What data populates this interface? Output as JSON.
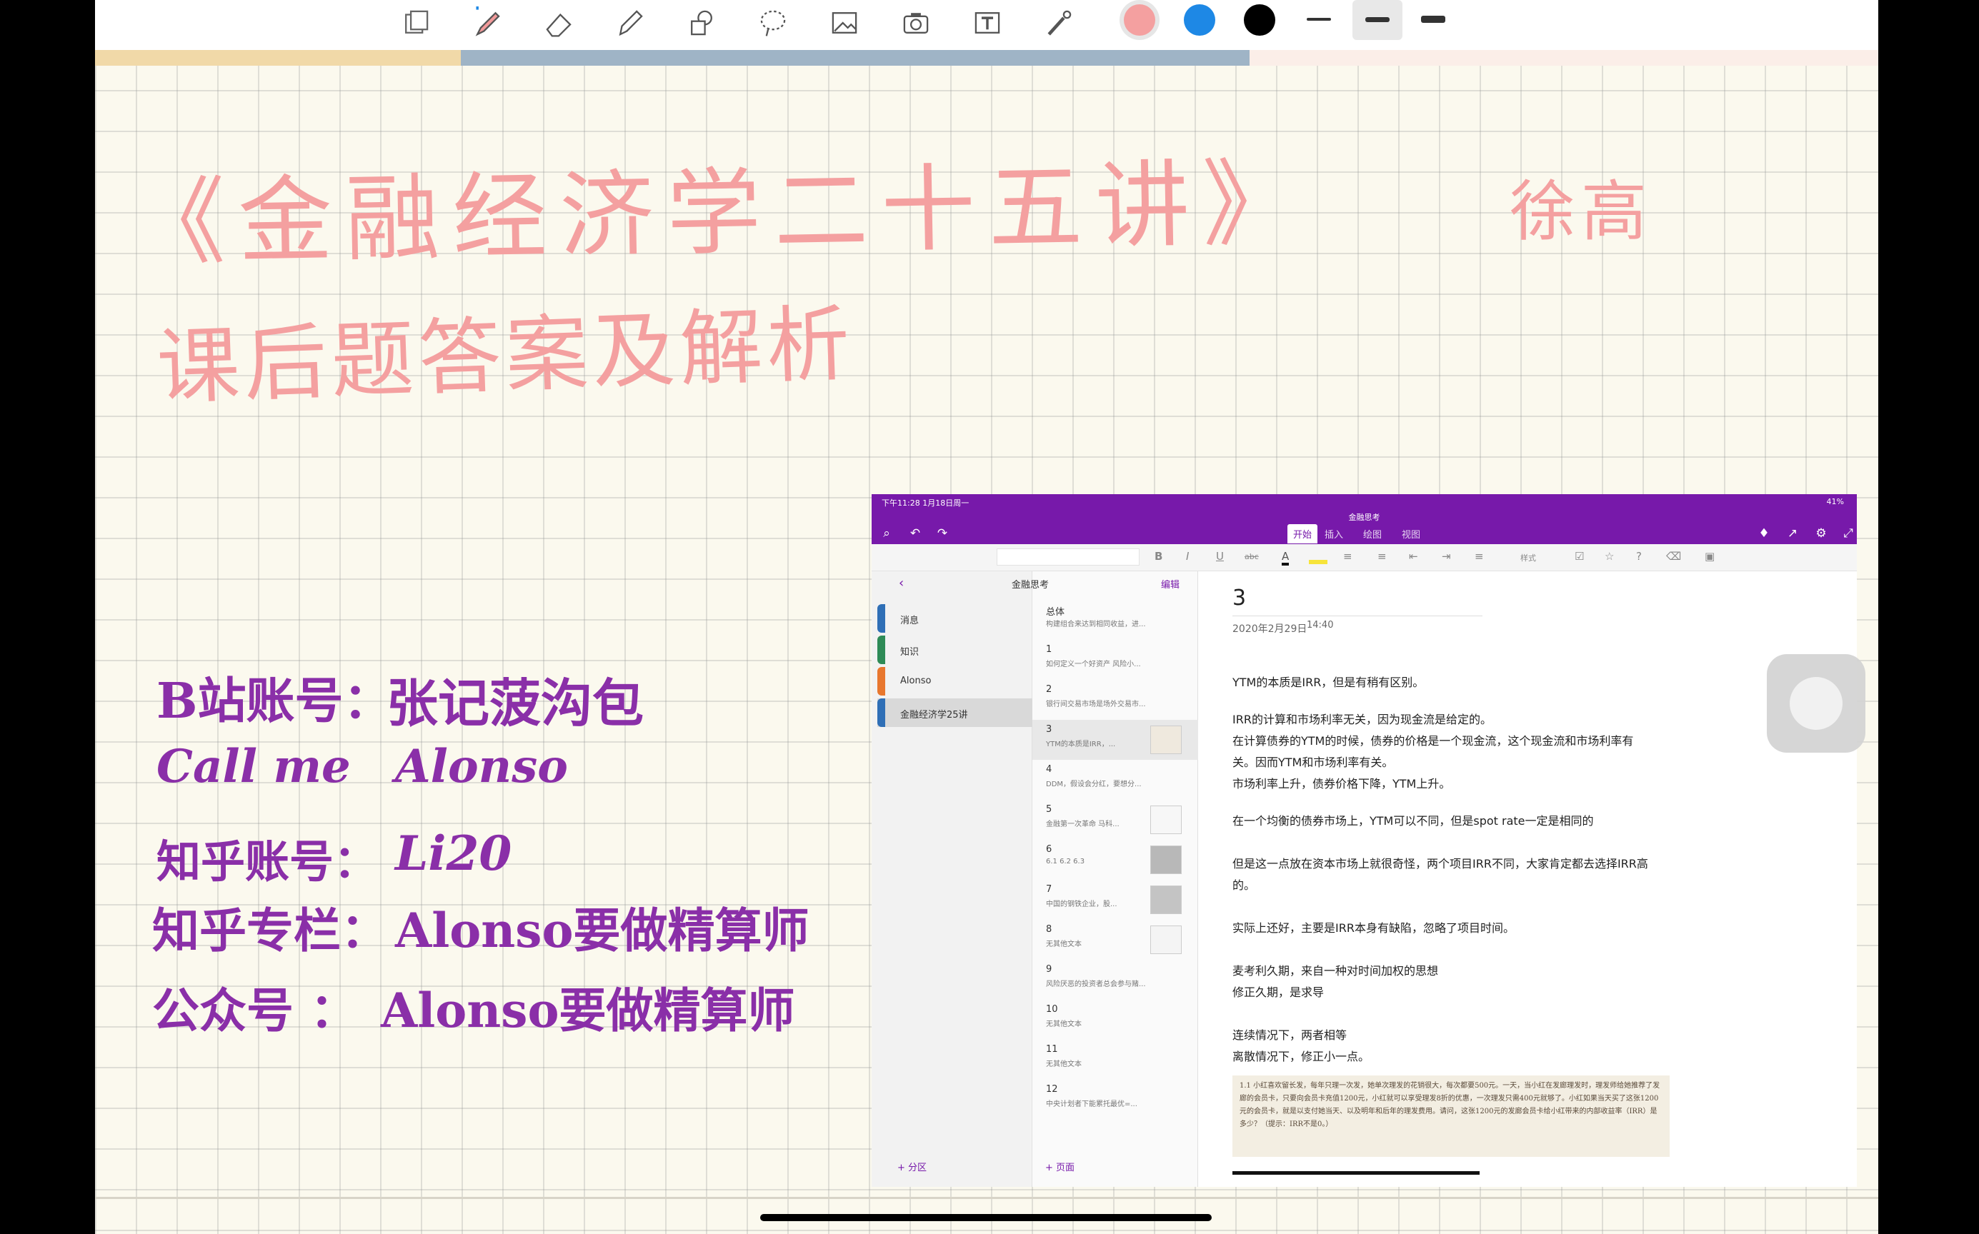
{
  "toolbar": {
    "tools": [
      "page-icon",
      "pen-icon",
      "eraser-icon",
      "highlighter-icon",
      "shapes-icon",
      "lasso-icon",
      "image-icon",
      "camera-icon",
      "text-icon",
      "laser-icon"
    ],
    "colors": [
      "#f4a0a0",
      "#1e88e5",
      "#000000"
    ]
  },
  "note": {
    "title": "《金融经济学二十五讲》",
    "author": "徐高",
    "subtitle": "课后题答案及解析",
    "info": [
      {
        "label": "B站账号：",
        "value": "张记菠沟包"
      },
      {
        "label": "Call  me",
        "value": "Alonso"
      },
      {
        "label": "知乎账号：",
        "value": "Li20"
      },
      {
        "label": "知乎专栏：",
        "value": "Alonso要做精算师"
      },
      {
        "label": "公众号 ：",
        "value": "Alonso要做精算师"
      }
    ]
  },
  "onenote": {
    "status_left": "下午11:28  1月18日周一",
    "status_right": "41%",
    "notebook": "金融思考",
    "tabs": [
      "开始",
      "插入",
      "绘图",
      "视图"
    ],
    "ribbon": [
      "B",
      "I",
      "U",
      "abc",
      "A",
      "样式",
      "?"
    ],
    "sections_header": "金融思考",
    "edit": "编辑",
    "sections": [
      {
        "name": "消息",
        "color": "#2f6fb6"
      },
      {
        "name": "知识",
        "color": "#2e8b57"
      },
      {
        "name": "Alonso",
        "color": "#e8772e"
      },
      {
        "name": "金融经济学25讲",
        "color": "#2f6fb6"
      }
    ],
    "pages": [
      {
        "title": "总体",
        "snippet": "构建组合来达到相同收益，进..."
      },
      {
        "title": "1",
        "snippet": "如何定义一个好资产  风险小..."
      },
      {
        "title": "2",
        "snippet": "银行间交易市场是场外交易市..."
      },
      {
        "title": "3",
        "snippet": "YTM的本质是IRR，..."
      },
      {
        "title": "4",
        "snippet": "DDM，假设会分红，要想分..."
      },
      {
        "title": "5",
        "snippet": "金融第一次革命 马科..."
      },
      {
        "title": "6",
        "snippet": "6.1  6.2  6.3"
      },
      {
        "title": "7",
        "snippet": "中国的钢铁企业，股..."
      },
      {
        "title": "8",
        "snippet": "无其他文本"
      },
      {
        "title": "9",
        "snippet": "风险厌恶的投资者总会参与赌..."
      },
      {
        "title": "10",
        "snippet": "无其他文本"
      },
      {
        "title": "11",
        "snippet": "无其他文本"
      },
      {
        "title": "12",
        "snippet": "中央计划者下能累托最优=..."
      }
    ],
    "add_section": "+ 分区",
    "add_page": "+ 页面",
    "page_title": "3",
    "page_date": "2020年2月29日",
    "page_time": "14:40",
    "body": [
      "YTM的本质是IRR，但是有稍有区别。",
      "IRR的计算和市场利率无关，因为现金流是给定的。",
      "在计算债券的YTM的时候，债券的价格是一个现金流，这个现金流和市场利率有",
      "关。因而YTM和市场利率有关。",
      "市场利率上升，债券价格下降，YTM上升。",
      "在一个均衡的债券市场上，YTM可以不同，但是spot rate一定是相同的",
      "但是这一点放在资本市场上就很奇怪，两个项目IRR不同，大家肯定都去选择IRR高",
      "的。",
      "实际上还好，主要是IRR本身有缺陷，忽略了项目时间。",
      "麦考利久期，来自一种对时间加权的思想",
      "修正久期，是求导",
      "连续情况下，两者相等",
      "离散情况下，修正小一点。"
    ],
    "book_excerpt": "1.1  小红喜欢留长发，每年只理一次发，她单次理发的花销很大，每次都要500元。一天，当小红在发廊理发时，理发师给她推荐了发廊的会员卡，只要向会员卡充值1200元，小红就可以享受理发8折的优惠，一次理发只需400元就够了。小红如果当天买了这张1200元的会员卡，就是以支付她当天、以及明年和后年的理发费用。请问，这张1200元的发廊会员卡给小红带来的内部收益率（IRR）是多少？（提示：IRR不是0。）"
  }
}
